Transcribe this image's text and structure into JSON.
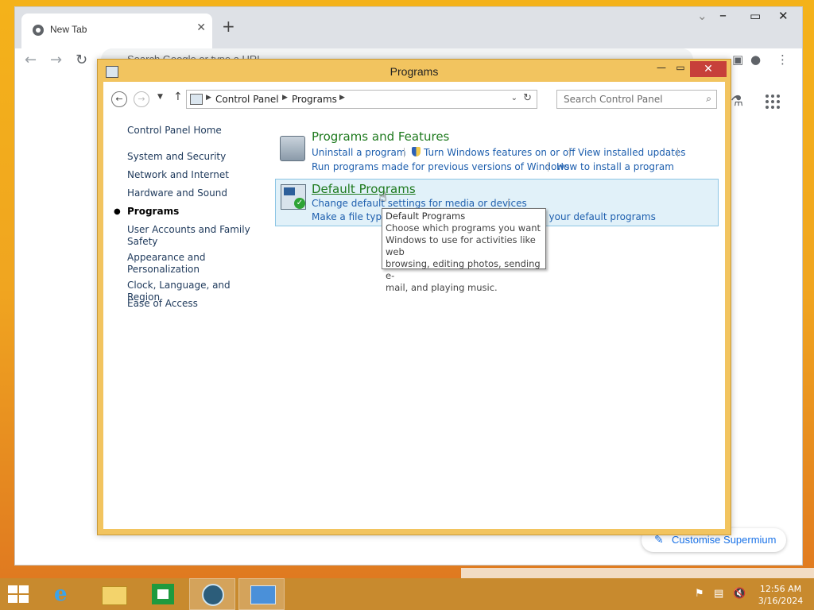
{
  "browser": {
    "tab_title": "New Tab",
    "omnibox_placeholder": "Search Google or type a URL",
    "customise_label": "Customise Supermium"
  },
  "cp": {
    "window_title": "Programs",
    "breadcrumbs": [
      "Control Panel",
      "Programs"
    ],
    "search_placeholder": "Search Control Panel",
    "left_nav": [
      {
        "label": "Control Panel Home",
        "active": false
      },
      {
        "label": "System and Security",
        "active": false
      },
      {
        "label": "Network and Internet",
        "active": false
      },
      {
        "label": "Hardware and Sound",
        "active": false
      },
      {
        "label": "Programs",
        "active": true
      },
      {
        "label": "User Accounts and Family Safety",
        "active": false
      },
      {
        "label": "Appearance and Personalization",
        "active": false
      },
      {
        "label": "Clock, Language, and Region",
        "active": false
      },
      {
        "label": "Ease of Access",
        "active": false
      }
    ],
    "categories": [
      {
        "heading": "Programs and Features",
        "links": [
          "Uninstall a program",
          "Turn Windows features on or off",
          "View installed updates",
          "Run programs made for previous versions of Windows",
          "How to install a program"
        ]
      },
      {
        "heading": "Default Programs",
        "links": [
          "Change default settings for media or devices",
          "Make a file type",
          "Set your default programs"
        ]
      }
    ],
    "tooltip": {
      "title": "Default Programs",
      "lines": [
        "Choose which programs you want",
        "Windows to use for activities like web",
        "browsing, editing photos, sending e-",
        "mail, and playing music."
      ]
    }
  },
  "taskbar": {
    "apps": [
      "start-button",
      "internet-explorer-icon",
      "file-explorer-icon",
      "store-icon",
      "browser-icon",
      "control-panel-icon"
    ],
    "time": "12:56 AM",
    "date": "3/16/2024"
  },
  "colors": {
    "window_frame": "#f2c45f",
    "close_red": "#c7403a",
    "category_heading": "#1e7a1e",
    "link_blue": "#1e5fae",
    "hover_bg": "#e1f1f9"
  }
}
